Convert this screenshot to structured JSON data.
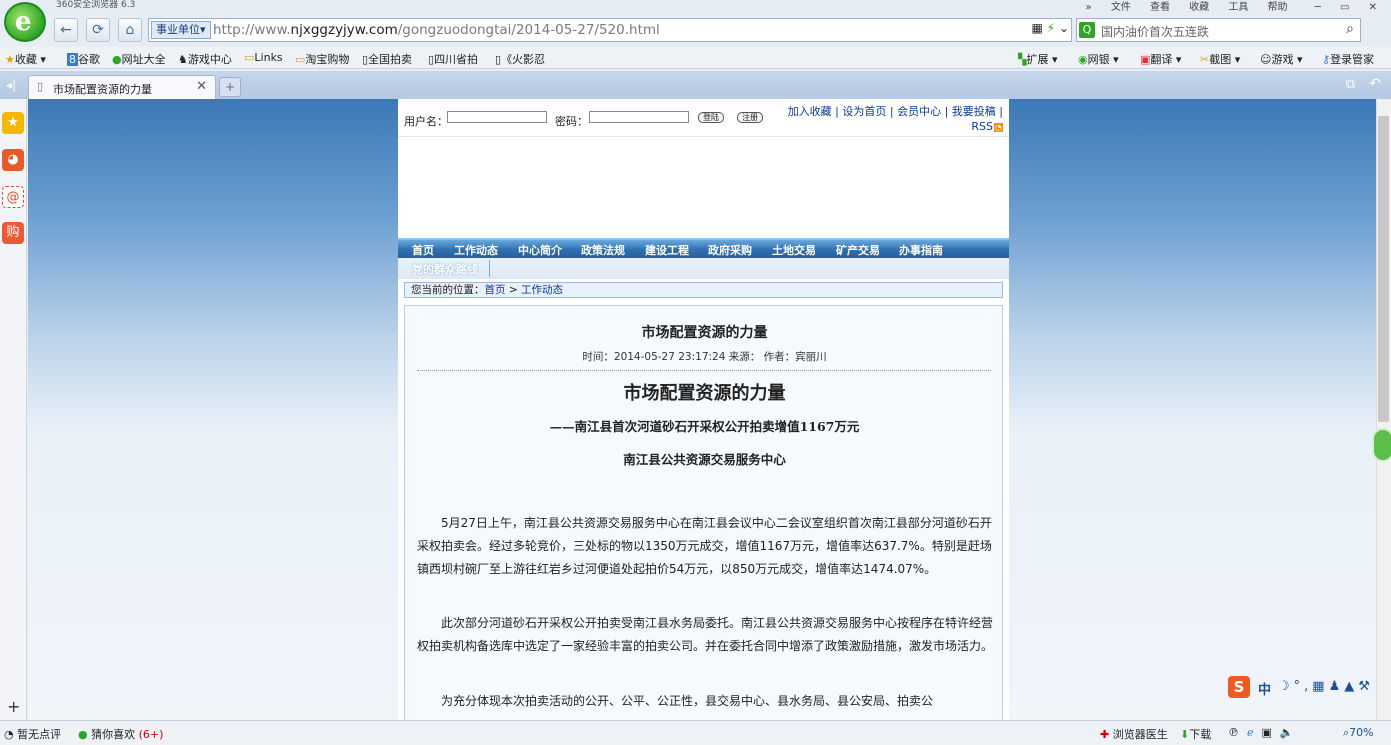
{
  "browser": {
    "title": "360安全浏览器 6.3",
    "menu": [
      "»",
      "文件",
      "查看",
      "收藏",
      "工具",
      "帮助"
    ],
    "address_tag": "事业单位",
    "url_prefix": "http://www.",
    "url_domain": "njxggzyjyw.com",
    "url_path": "/gongzuodongtai/2014-05-27/520.html",
    "search_text": "国内油价首次五连跌",
    "favorites": [
      "收藏",
      "谷歌",
      "网址大全",
      "游戏中心",
      "Links",
      "淘宝购物",
      "全国拍卖",
      "四川省拍",
      "《火影忍"
    ],
    "toolbar_right": [
      "扩展",
      "网银",
      "翻译",
      "截图",
      "游戏",
      "登录管家"
    ],
    "tab_title": "市场配置资源的力量"
  },
  "site": {
    "login_user_label": "用户名：",
    "login_pass_label": "密码：",
    "login_btn": "登陆",
    "register_btn": "注册",
    "top_links_line1": "加入收藏 | 设为首页 | 会员中心 | 我要投稿 |",
    "top_links_rss": "RSS",
    "nav": [
      "首页",
      "工作动态",
      "中心简介",
      "政策法规",
      "建设工程",
      "政府采购",
      "土地交易",
      "矿产交易",
      "办事指南"
    ],
    "nav2": "党的群众路线",
    "crumb_label": "您当前的位置：",
    "crumb_home": "首页",
    "crumb_sep": ">",
    "crumb_current": "工作动态"
  },
  "article": {
    "title": "市场配置资源的力量",
    "meta": "时间：2014-05-27 23:17:24 来源： 作者：宾丽川",
    "heading": "市场配置资源的力量",
    "subheading": "——南江县首次河道砂石开采权公开拍卖增值1167万元",
    "org": "南江县公共资源交易服务中心",
    "p1": "5月27日上午，南江县公共资源交易服务中心在南江县会议中心二会议室组织首次南江县部分河道砂石开采权拍卖会。经过多轮竞价，三处标的物以1350万元成交，增值1167万元，增值率达637.7%。特别是赶场镇西坝村碗厂至上游往红岩乡过河便道处起拍价54万元，以850万元成交，增值率达1474.07%。",
    "p2": "此次部分河道砂石开采权公开拍卖受南江县水务局委托。南江县公共资源交易服务中心按程序在特许经营权拍卖机构备选库中选定了一家经验丰富的拍卖公司。并在委托合同中增添了政策激励措施，激发市场活力。",
    "p3": "为充分体现本次拍卖活动的公开、公平、公正性，县交易中心、县水务局、县公安局、拍卖公"
  },
  "status": {
    "left1": "暂无点评",
    "left2": "猜你喜欢",
    "left2_count": "(6+)",
    "right": [
      "浏览器医生",
      "下载",
      "70%"
    ],
    "ime": "中"
  }
}
